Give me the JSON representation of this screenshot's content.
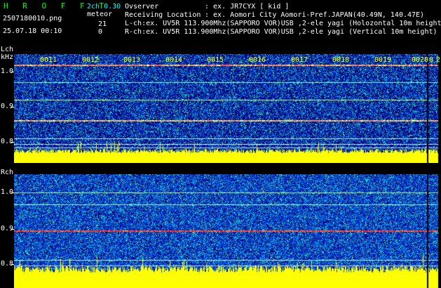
{
  "app": {
    "title": "H R O F F T"
  },
  "header": {
    "filename": "2507180010.png",
    "datetime": "25.07.18 00:10",
    "mode": "2ch 0.30",
    "meteor_label": "meteor",
    "count_l": "21",
    "count_r": "0",
    "observer_label": "Ovserver",
    "observer_value": ": ex. JR7CYX [ kid ]",
    "location_label": "Receiving Location",
    "location_value": ": ex. Aomori City Aomori-Pref.JAPAN(40.49N, 140.47E)",
    "lch_line": "L-ch:ex. UV5R 113.900Mhz(SAPPORO VOR)USB ,2-ele yagi (Holozontal 10m height)",
    "rch_line": "R-ch:ex. UV5R 113.900Mhz(SAPPORO VOR)USB ,2-ele yagi (Vertical 10m height)"
  },
  "left_channel": {
    "label": "Lch",
    "unit": "kHz",
    "ticks": [
      "1.0",
      "0.9",
      "0.8"
    ]
  },
  "right_channel": {
    "label": "Rch",
    "ticks": [
      "1.0",
      "0.9",
      "0.8"
    ]
  },
  "time_segments": [
    "0011",
    "0012",
    "0013",
    "0014",
    "0015",
    "0016",
    "0017",
    "0018",
    "0019",
    "0020",
    "0",
    "2"
  ],
  "colors": {
    "title": "#00ff00",
    "cyan_text": "#00ffff",
    "segment_text": "#ffff00",
    "amplitude_bar": "#ffff00",
    "noise_floor": "#0000aa",
    "strong_line": "#ff2020"
  }
}
